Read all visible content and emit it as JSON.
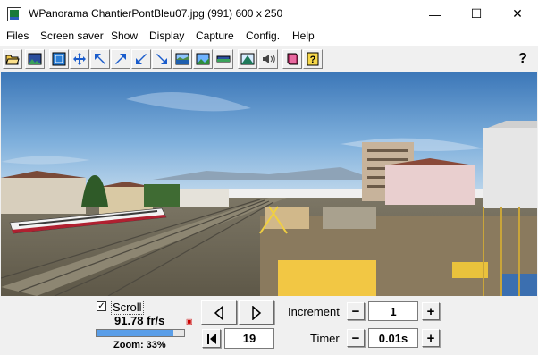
{
  "window": {
    "title": "WPanorama  ChantierPontBleu07.jpg   (991) 600 x 250",
    "minimize_glyph": "—",
    "maximize_glyph": "☐",
    "close_glyph": "✕"
  },
  "menu": [
    "Files",
    "Screen saver",
    "Show",
    "Display",
    "Capture",
    "Config.",
    "Help"
  ],
  "toolbar": {
    "icons": [
      "open-file-icon",
      "picture-icon",
      "fit-icon",
      "move-icon",
      "arrow-left-up-icon",
      "arrow-right-up-icon",
      "arrow-left-down-icon",
      "arrow-right-down-icon",
      "lake-icon",
      "landscape-icon",
      "panorama-strip-icon",
      "mountain-icon",
      "speaker-icon",
      "book-icon",
      "help-book-icon"
    ],
    "help_label": "?"
  },
  "controls": {
    "scroll_checked": true,
    "scroll_label": "Scroll",
    "fps": "91.78 fr/s",
    "progress_fraction": 0.88,
    "zoom": "Zoom: 33%",
    "frame_value": "19",
    "increment_label": "Increment",
    "increment_value": "1",
    "timer_label": "Timer",
    "timer_value": "0.01s",
    "minus_glyph": "−",
    "plus_glyph": "+",
    "check_glyph": "✓"
  },
  "colors": {
    "progress": "#5a9ee8",
    "sky": "#5f93c6"
  }
}
